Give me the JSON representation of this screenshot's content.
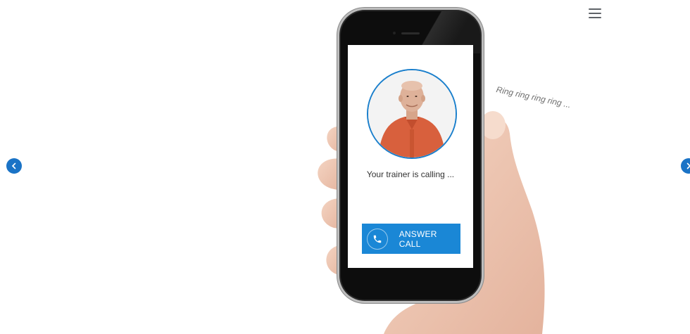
{
  "header": {
    "menu_icon": "hamburger-menu-icon"
  },
  "carousel": {
    "prev_icon": "chevron-left-icon",
    "next_icon": "chevron-right-icon",
    "accent_color": "#1a73c6"
  },
  "caption": {
    "ring_text": "Ring ring ring ring ..."
  },
  "phone": {
    "caller_status": "Your trainer is calling ...",
    "answer_label": "ANSWER CALL",
    "answer_icon": "phone-icon",
    "button_color": "#1a87d6"
  }
}
